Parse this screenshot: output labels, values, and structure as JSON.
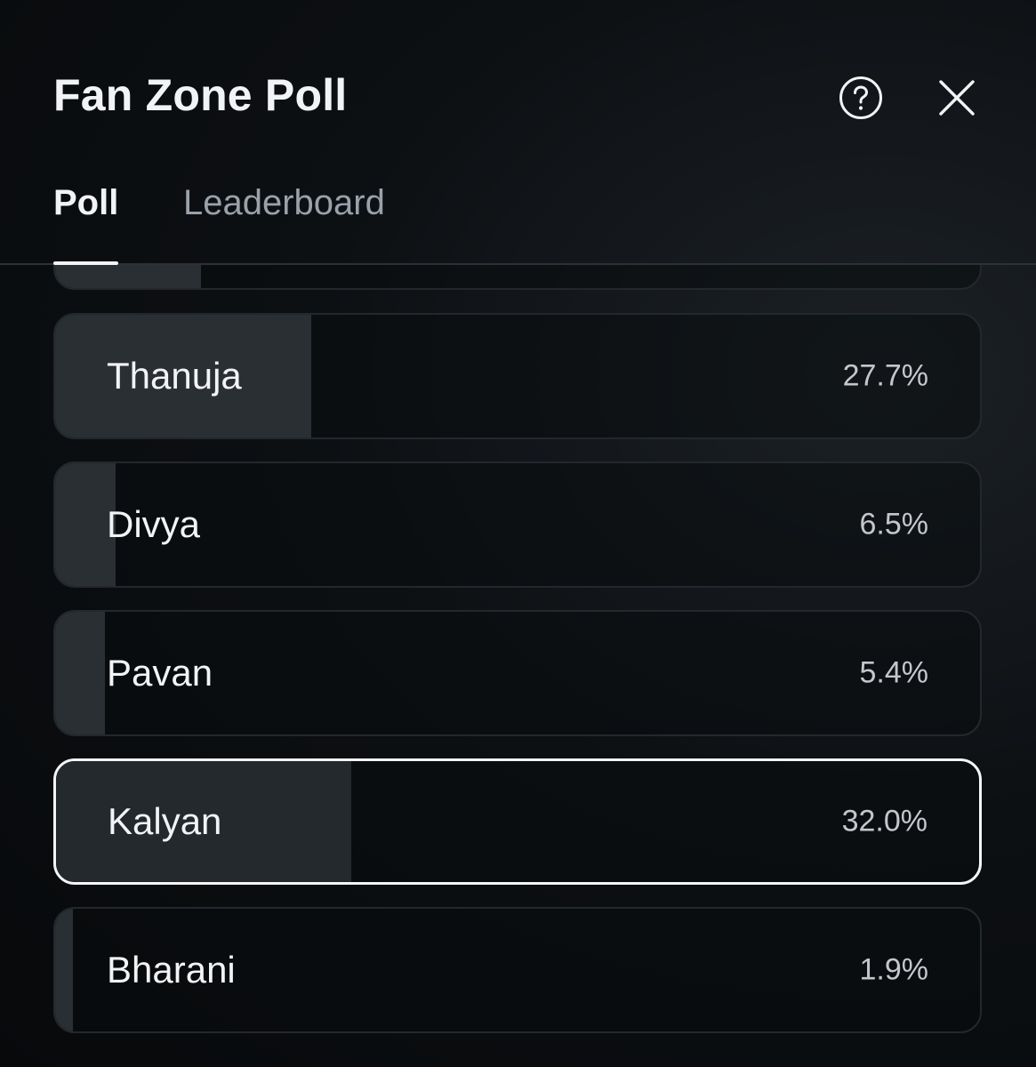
{
  "header": {
    "title": "Fan Zone Poll",
    "help_icon": "help-circle-icon",
    "close_icon": "close-icon"
  },
  "tabs": [
    {
      "label": "Poll",
      "active": true
    },
    {
      "label": "Leaderboard",
      "active": false
    }
  ],
  "poll": {
    "partial_option": {
      "percent": 15.8
    },
    "options": [
      {
        "name": "Thanuja",
        "percent_label": "27.7%",
        "percent": 27.7,
        "selected": false
      },
      {
        "name": "Divya",
        "percent_label": "6.5%",
        "percent": 6.5,
        "selected": false
      },
      {
        "name": "Pavan",
        "percent_label": "5.4%",
        "percent": 5.4,
        "selected": false
      },
      {
        "name": "Kalyan",
        "percent_label": "32.0%",
        "percent": 32.0,
        "selected": true
      },
      {
        "name": "Bharani",
        "percent_label": "1.9%",
        "percent": 1.9,
        "selected": false
      }
    ]
  },
  "colors": {
    "background": "#0d1013",
    "fill": "#2a2f34",
    "selected_border": "#f4f5f6",
    "text_primary": "#f2f3f5",
    "text_muted": "#9aa1aa"
  }
}
